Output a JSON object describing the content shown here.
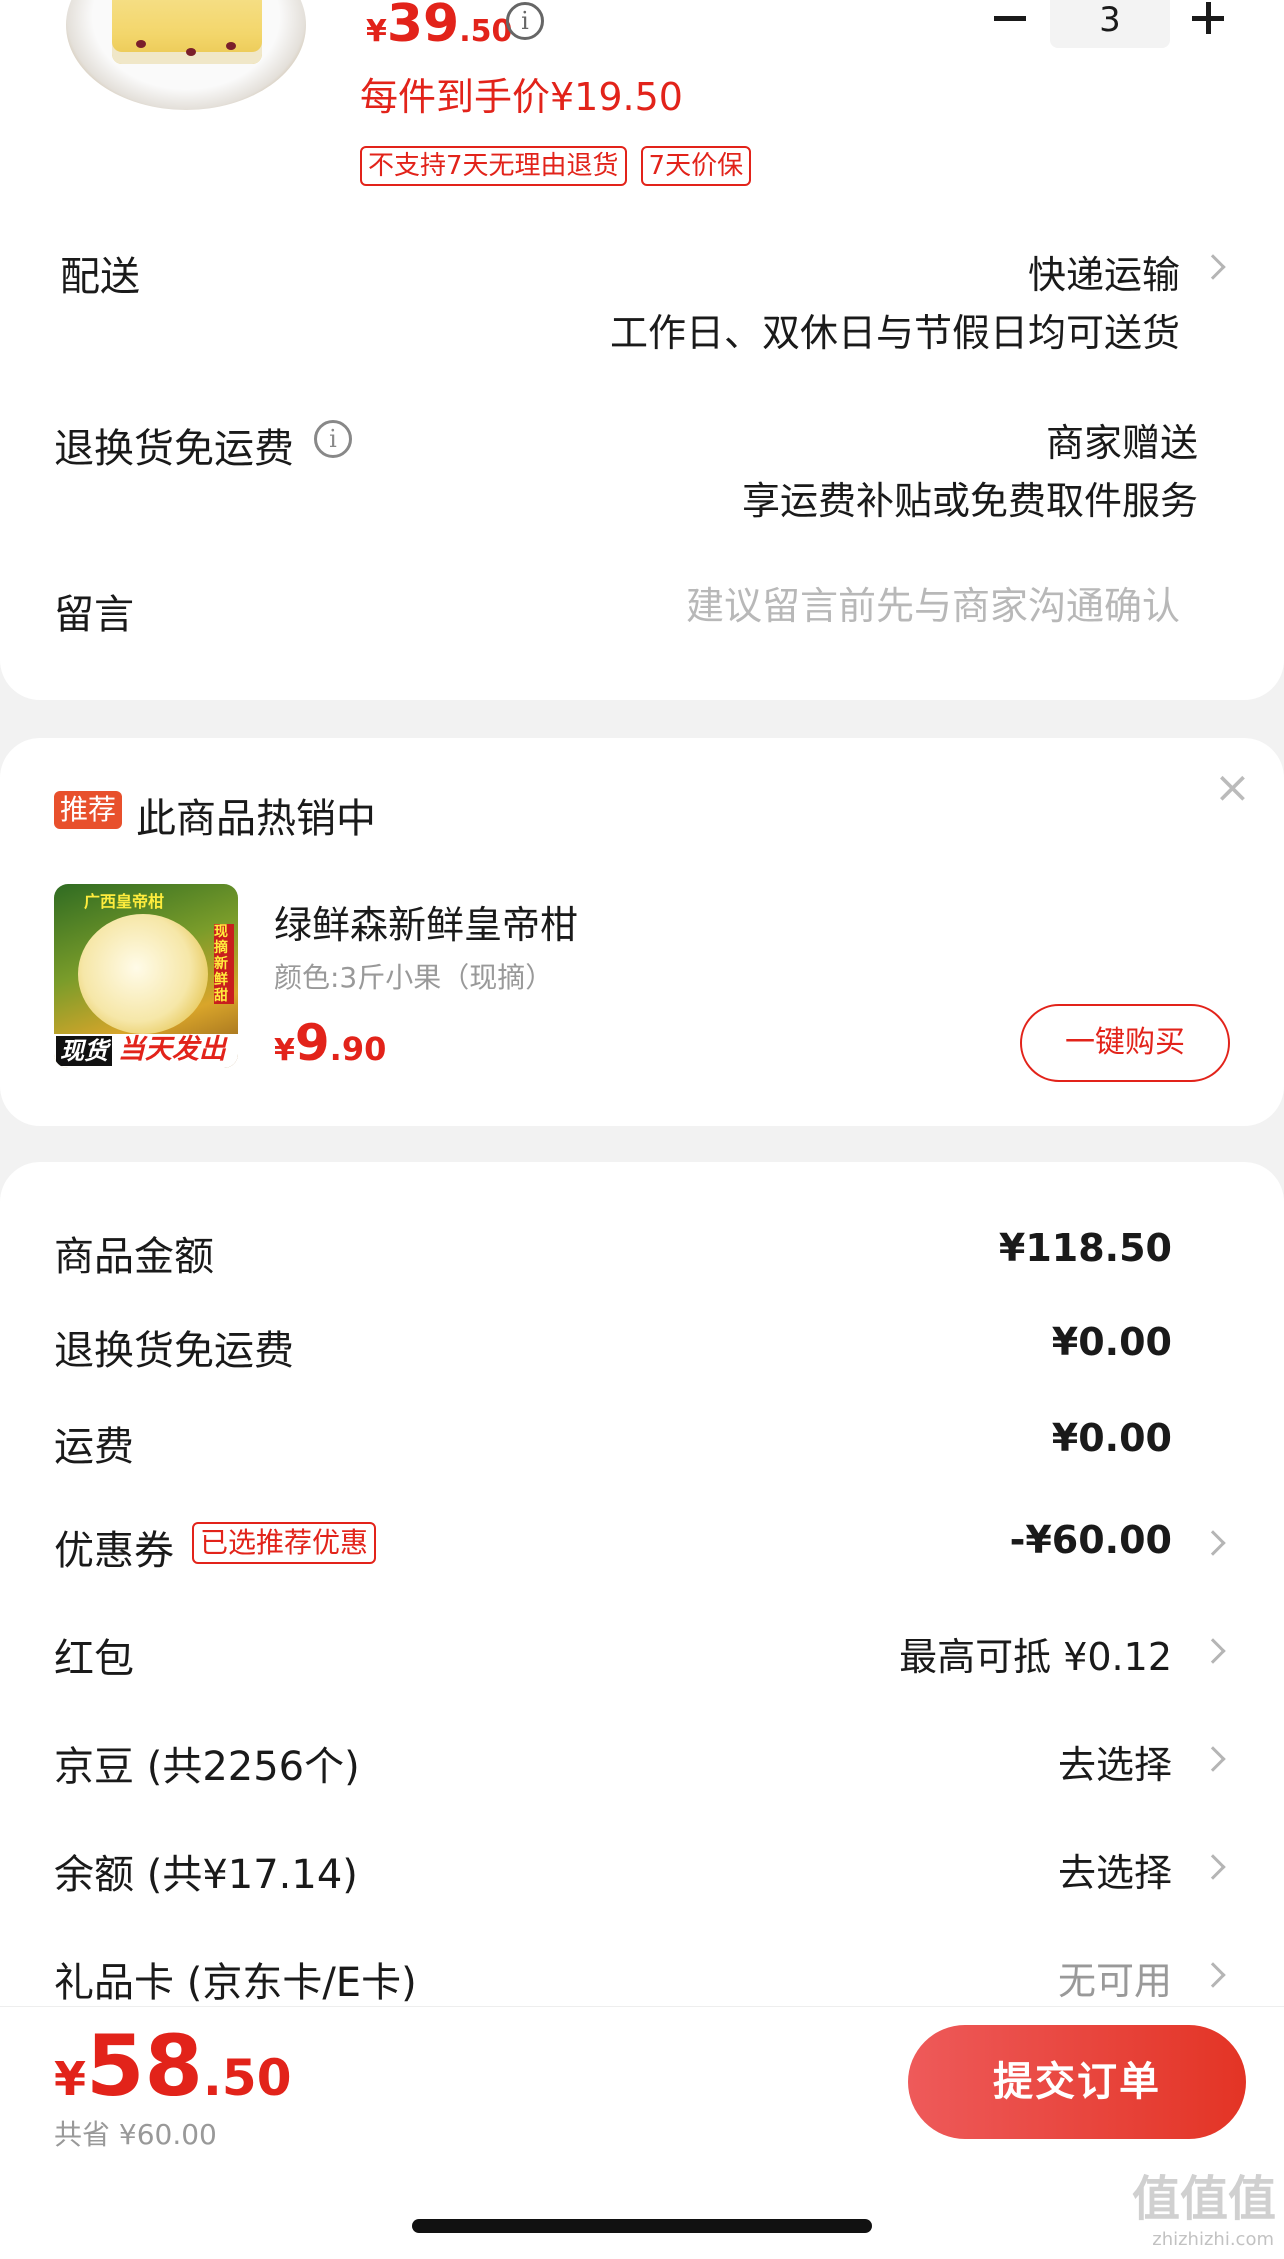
{
  "product": {
    "price_symbol": "¥",
    "price_int": "39",
    "price_dec": ".50",
    "per_item_price": "每件到手价¥19.50",
    "tags": [
      "不支持7天无理由退货",
      "7天价保"
    ],
    "quantity": "3",
    "minus_label": "−",
    "plus_label": "+"
  },
  "delivery": {
    "label": "配送",
    "method": "快递运输",
    "note": "工作日、双休日与节假日均可送货"
  },
  "return_shipping": {
    "label": "退换货免运费",
    "value": "商家赠送",
    "note": "享运费补贴或免费取件服务"
  },
  "message": {
    "label": "留言",
    "placeholder": "建议留言前先与商家沟通确认"
  },
  "recommend": {
    "badge": "推荐",
    "title": "此商品热销中",
    "close": "×",
    "image_text_top": "广西皇帝柑",
    "image_text_side": "现摘 新鲜甜",
    "image_text_left": "现货",
    "image_text_right": "当天发出",
    "name": "绿鲜森新鲜皇帝柑",
    "spec": "颜色:3斤小果（现摘）",
    "price_symbol": "¥",
    "price_int": "9",
    "price_dec": ".90",
    "buy_button": "一键购买"
  },
  "summary": {
    "rows": [
      {
        "label": "商品金额",
        "value": "¥118.50"
      },
      {
        "label": "退换货免运费",
        "value": "¥0.00"
      },
      {
        "label": "运费",
        "value": "¥0.00"
      }
    ],
    "coupon": {
      "label": "优惠券",
      "tag": "已选推荐优惠",
      "value": "-¥60.00"
    },
    "redpacket": {
      "label": "红包",
      "value": "最高可抵 ¥0.12"
    },
    "jingdou": {
      "label": "京豆 (共2256个)",
      "value": "去选择"
    },
    "balance": {
      "label": "余额 (共¥17.14)",
      "value": "去选择"
    },
    "giftcard": {
      "label": "礼品卡 (京东卡/E卡)",
      "value": "无可用"
    }
  },
  "footer": {
    "price_symbol": "¥",
    "price_int": "58",
    "price_dec": ".50",
    "saved": "共省 ¥60.00",
    "submit": "提交订单"
  },
  "watermark": {
    "logo": "值值值",
    "url": "zhizhizhi.com"
  },
  "colors": {
    "accent": "#e2231a",
    "submit_gradient_start": "#ee5a5a",
    "submit_gradient_end": "#e33425",
    "muted": "#999999"
  }
}
